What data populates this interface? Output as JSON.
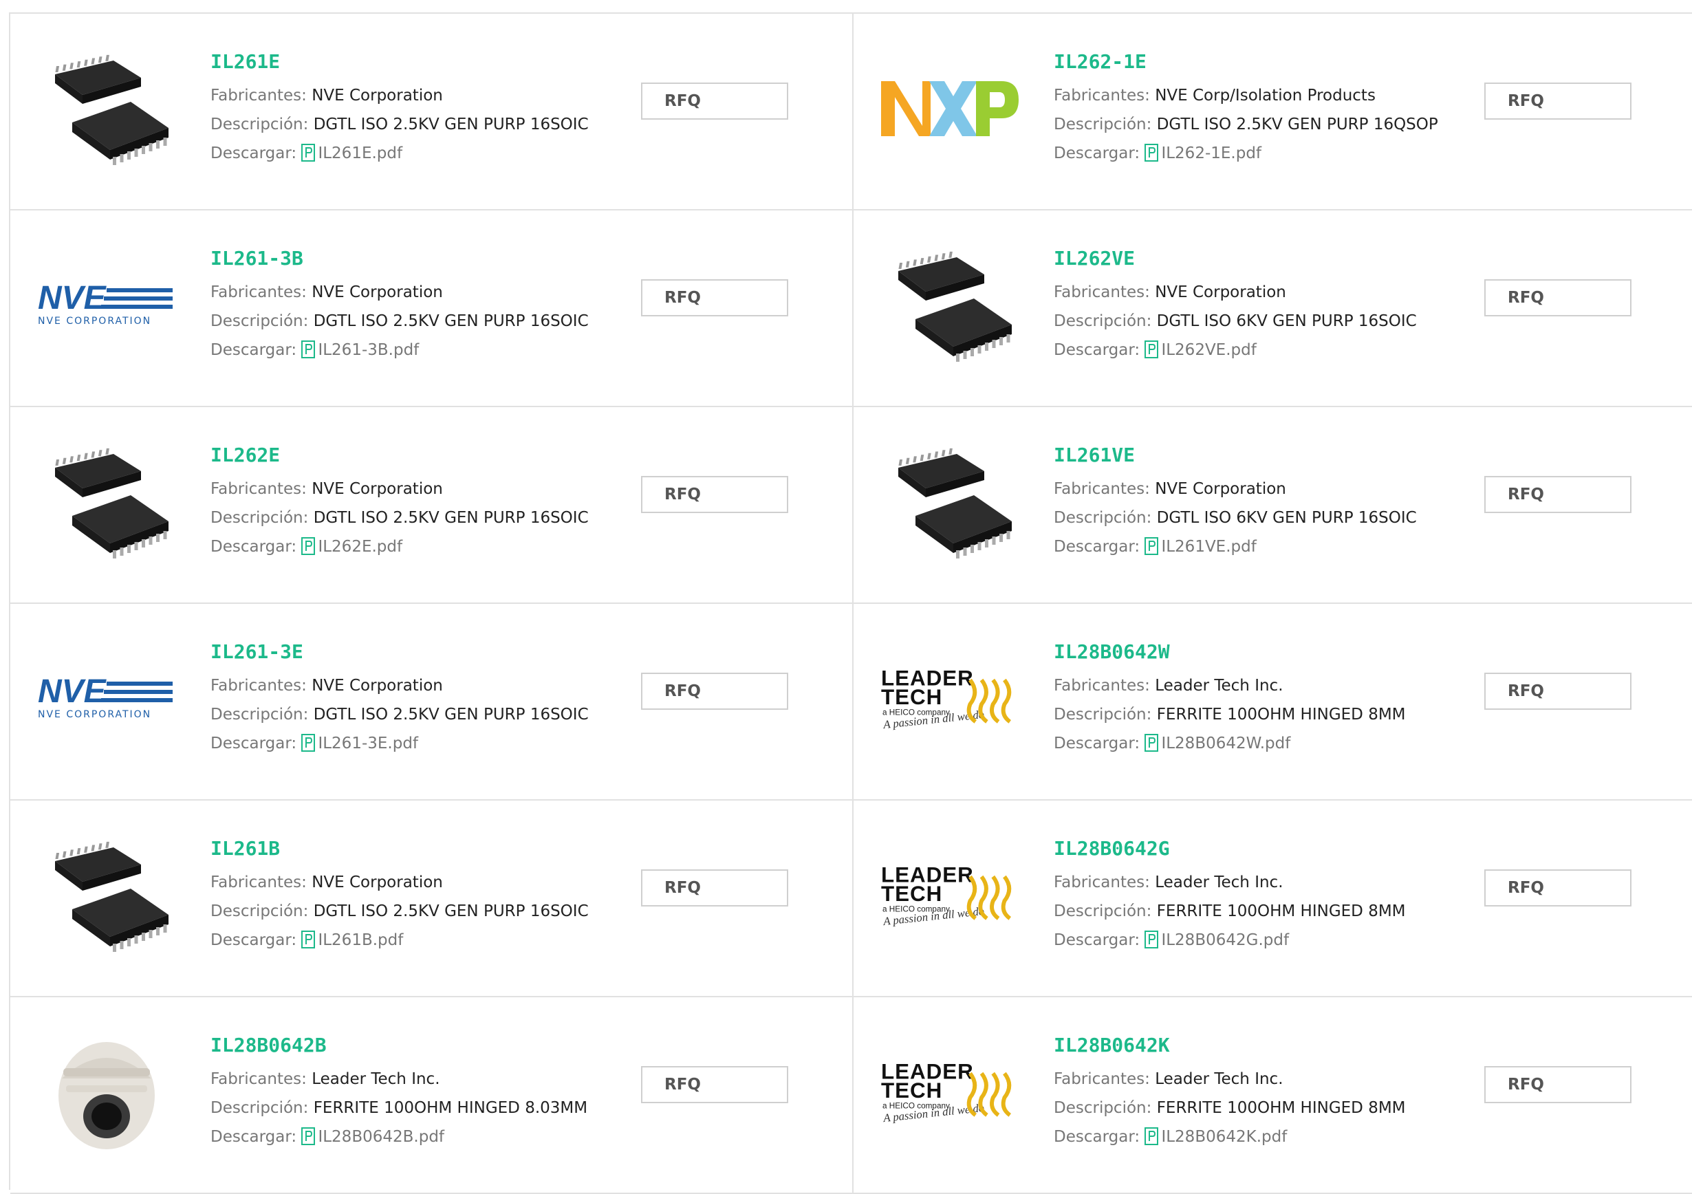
{
  "labels": {
    "manufacturer": "Fabricantes:",
    "description": "Descripción:",
    "download": "Descargar:",
    "rfq": "RFQ"
  },
  "products": [
    {
      "part": "IL261E",
      "maker": "NVE Corporation",
      "desc": "DGTL ISO 2.5KV GEN PURP 16SOIC",
      "pdf": "IL261E.pdf",
      "image": "chip-image"
    },
    {
      "part": "IL262-1E",
      "maker": "NVE Corp/Isolation Products",
      "desc": "DGTL ISO 2.5KV GEN PURP 16QSOP",
      "pdf": "IL262-1E.pdf",
      "image": "nxp-logo"
    },
    {
      "part": "IL261-3B",
      "maker": "NVE Corporation",
      "desc": "DGTL ISO 2.5KV GEN PURP 16SOIC",
      "pdf": "IL261-3B.pdf",
      "image": "nve-logo"
    },
    {
      "part": "IL262VE",
      "maker": "NVE Corporation",
      "desc": "DGTL ISO 6KV GEN PURP 16SOIC",
      "pdf": "IL262VE.pdf",
      "image": "chip-image"
    },
    {
      "part": "IL262E",
      "maker": "NVE Corporation",
      "desc": "DGTL ISO 2.5KV GEN PURP 16SOIC",
      "pdf": "IL262E.pdf",
      "image": "chip-image"
    },
    {
      "part": "IL261VE",
      "maker": "NVE Corporation",
      "desc": "DGTL ISO 6KV GEN PURP 16SOIC",
      "pdf": "IL261VE.pdf",
      "image": "chip-image"
    },
    {
      "part": "IL261-3E",
      "maker": "NVE Corporation",
      "desc": "DGTL ISO 2.5KV GEN PURP 16SOIC",
      "pdf": "IL261-3E.pdf",
      "image": "nve-logo"
    },
    {
      "part": "IL28B0642W",
      "maker": "Leader Tech Inc.",
      "desc": "FERRITE 100OHM HINGED 8MM",
      "pdf": "IL28B0642W.pdf",
      "image": "leader-tech-logo"
    },
    {
      "part": "IL261B",
      "maker": "NVE Corporation",
      "desc": "DGTL ISO 2.5KV GEN PURP 16SOIC",
      "pdf": "IL261B.pdf",
      "image": "chip-image"
    },
    {
      "part": "IL28B0642G",
      "maker": "Leader Tech Inc.",
      "desc": "FERRITE 100OHM HINGED 8MM",
      "pdf": "IL28B0642G.pdf",
      "image": "leader-tech-logo"
    },
    {
      "part": "IL28B0642B",
      "maker": "Leader Tech Inc.",
      "desc": "FERRITE 100OHM HINGED 8.03MM",
      "pdf": "IL28B0642B.pdf",
      "image": "ferrite-image"
    },
    {
      "part": "IL28B0642K",
      "maker": "Leader Tech Inc.",
      "desc": "FERRITE 100OHM HINGED 8MM",
      "pdf": "IL28B0642K.pdf",
      "image": "leader-tech-logo"
    }
  ],
  "logos": {
    "nve": {
      "word": "NVE",
      "sub": "NVE CORPORATION"
    },
    "leader": {
      "line1": "LEADER",
      "line2": "TECH",
      "tag": "a HEICO company",
      "slogan": "A passion in all we do"
    }
  },
  "colors": {
    "part_green": "#1cb98a",
    "nve_blue": "#1f5fa8",
    "nxp_orange": "#f5a623",
    "nxp_blue": "#7fc6e8",
    "nxp_green": "#9acd32"
  }
}
